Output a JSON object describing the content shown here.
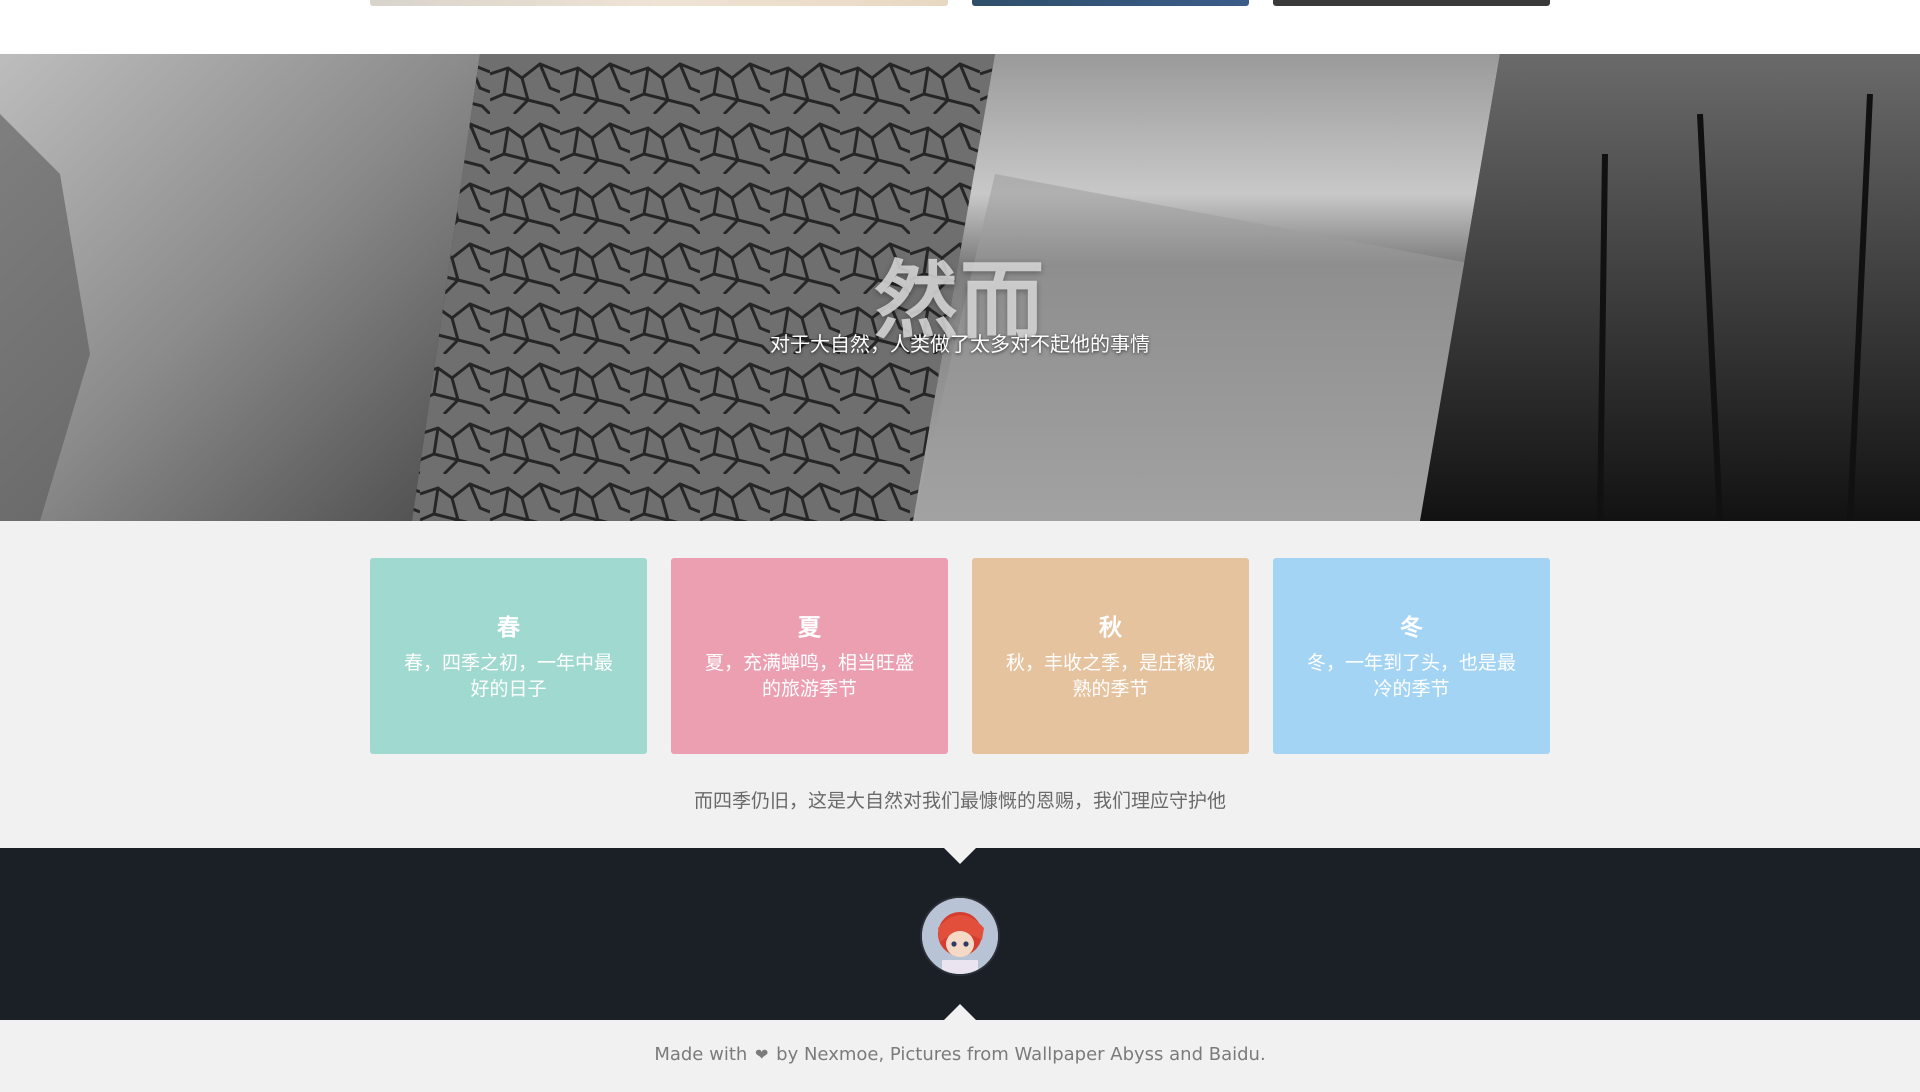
{
  "hero": {
    "title": "然而",
    "subtitle": "对于大自然，人类做了太多对不起他的事情"
  },
  "seasons": [
    {
      "name": "春",
      "desc_line1": "春，四季之初，一年中最",
      "desc_line2": "好的日子",
      "color": "#a0d9cf"
    },
    {
      "name": "夏",
      "desc_line1": "夏，充满蝉鸣，相当旺盛",
      "desc_line2": "的旅游季节",
      "color": "#eb9fb1"
    },
    {
      "name": "秋",
      "desc_line1": "秋，丰收之季，是庄稼成",
      "desc_line2": "熟的季节",
      "color": "#e6c39f"
    },
    {
      "name": "冬",
      "desc_line1": "冬，一年到了头，也是最",
      "desc_line2": "冷的季节",
      "color": "#a4d4f4"
    }
  ],
  "closing_text": "而四季仍旧，这是大自然对我们最慷慨的恩赐，我们理应守护他",
  "footer": {
    "made_with": "Made with",
    "credit": "by Nexmoe, Pictures from Wallpaper Abyss and Baidu.",
    "heart_icon": "heart-icon"
  },
  "colors": {
    "dark_band": "#1b1f26",
    "page_bg": "#f1f1f1"
  }
}
